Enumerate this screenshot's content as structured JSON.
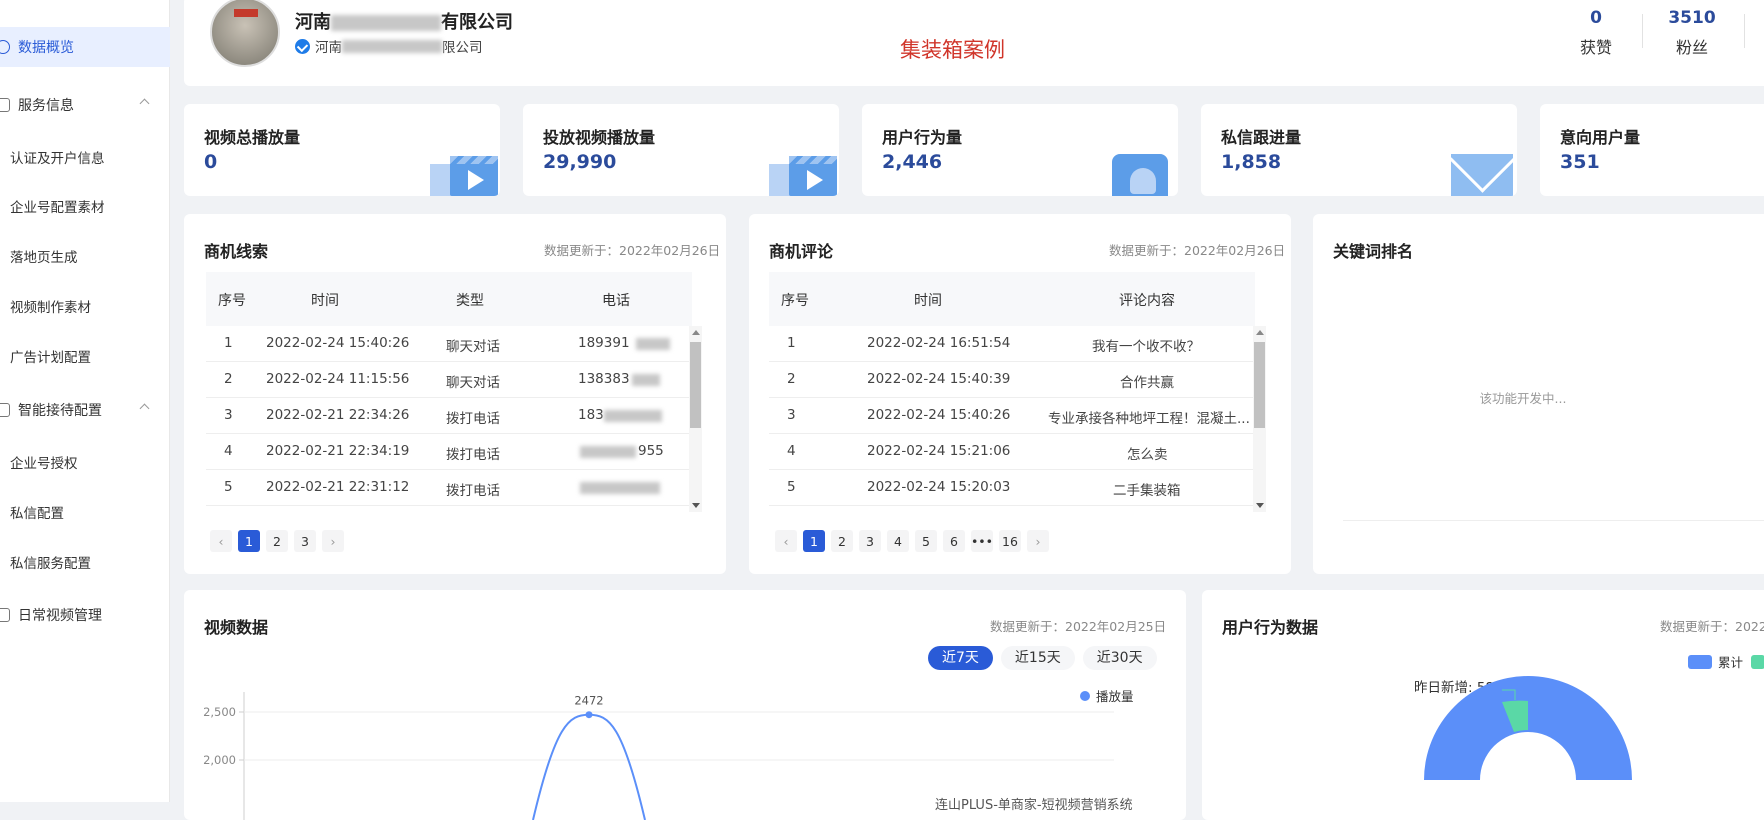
{
  "sidebar": {
    "items": [
      {
        "label": "数据概览",
        "type": "main",
        "active": true
      },
      {
        "label": "服务信息",
        "type": "group"
      },
      {
        "label": "认证及开户信息",
        "type": "sub"
      },
      {
        "label": "企业号配置素材",
        "type": "sub"
      },
      {
        "label": "落地页生成",
        "type": "sub"
      },
      {
        "label": "视频制作素材",
        "type": "sub"
      },
      {
        "label": "广告计划配置",
        "type": "sub"
      },
      {
        "label": "智能接待配置",
        "type": "group"
      },
      {
        "label": "企业号授权",
        "type": "sub"
      },
      {
        "label": "私信配置",
        "type": "sub"
      },
      {
        "label": "私信服务配置",
        "type": "sub"
      },
      {
        "label": "日常视频管理",
        "type": "main"
      }
    ]
  },
  "header": {
    "company_prefix": "河南",
    "company_suffix": "有限公司",
    "company_sub_prefix": "河南",
    "company_sub_suffix": "限公司",
    "case_title": "集装箱案例",
    "stats": [
      {
        "value": "0",
        "label": "获赞"
      },
      {
        "value": "3510",
        "label": "粉丝"
      }
    ]
  },
  "kpis": [
    {
      "title": "视频总播放量",
      "value": "0",
      "icon": "video-icon"
    },
    {
      "title": "投放视频播放量",
      "value": "29,990",
      "icon": "video-icon"
    },
    {
      "title": "用户行为量",
      "value": "2,446",
      "icon": "user-folder-icon"
    },
    {
      "title": "私信跟进量",
      "value": "1,858",
      "icon": "mail-icon"
    },
    {
      "title": "意向用户量",
      "value": "351",
      "icon": "none"
    }
  ],
  "leads": {
    "title": "商机线索",
    "updated": "数据更新于：2022年02月26日",
    "columns": [
      "序号",
      "时间",
      "类型",
      "电话"
    ],
    "rows": [
      {
        "no": "1",
        "time": "2022-02-24 15:40:26",
        "type": "聊天对话",
        "phone": "189391"
      },
      {
        "no": "2",
        "time": "2022-02-24 11:15:56",
        "type": "聊天对话",
        "phone": "138383"
      },
      {
        "no": "3",
        "time": "2022-02-21 22:34:26",
        "type": "拨打电话",
        "phone": "183"
      },
      {
        "no": "4",
        "time": "2022-02-21 22:34:19",
        "type": "拨打电话",
        "phone": "955"
      },
      {
        "no": "5",
        "time": "2022-02-21 22:31:12",
        "type": "拨打电话",
        "phone": ""
      }
    ],
    "pages": [
      "1",
      "2",
      "3"
    ]
  },
  "comments": {
    "title": "商机评论",
    "updated": "数据更新于：2022年02月26日",
    "columns": [
      "序号",
      "时间",
      "评论内容"
    ],
    "rows": [
      {
        "no": "1",
        "time": "2022-02-24 16:51:54",
        "content": "我有一个收不收？"
      },
      {
        "no": "2",
        "time": "2022-02-24 15:40:39",
        "content": "合作共赢"
      },
      {
        "no": "3",
        "time": "2022-02-24 15:40:26",
        "content": "专业承接各种地坪工程！混凝土..."
      },
      {
        "no": "4",
        "time": "2022-02-24 15:21:06",
        "content": "怎么卖"
      },
      {
        "no": "5",
        "time": "2022-02-24 15:20:03",
        "content": "二手集装箱"
      }
    ],
    "pages": [
      "1",
      "2",
      "3",
      "4",
      "5",
      "6",
      "•••",
      "16"
    ]
  },
  "keywords": {
    "title": "关键词排名",
    "note": "该功能开发中..."
  },
  "video_data": {
    "title": "视频数据",
    "updated": "数据更新于：2022年02月25日",
    "tabs": [
      "近7天",
      "近15天",
      "近30天"
    ],
    "legend": "播放量",
    "y_ticks": [
      "2,500",
      "2,000"
    ],
    "peak_label": "2472"
  },
  "user_behavior": {
    "title": "用户行为数据",
    "updated": "数据更新于：2022",
    "legend_total": "累计",
    "new_label": "昨日新增: 58"
  },
  "chart_data": {
    "type": "line",
    "series": [
      {
        "name": "播放量",
        "values": [
          null,
          null,
          null,
          2472,
          null,
          null,
          null
        ]
      }
    ],
    "ylim": [
      2000,
      2500
    ],
    "yticks": [
      2000,
      2500
    ]
  },
  "watermark": "连山PLUS-单商家-短视频营销系统",
  "colors": {
    "primary": "#2a5bd7",
    "kpi_value": "#2b4b9b",
    "case_title": "#d0352a",
    "line": "#5b8ff9",
    "donut_main": "#5b8ff9",
    "donut_new": "#5ad8a6"
  }
}
